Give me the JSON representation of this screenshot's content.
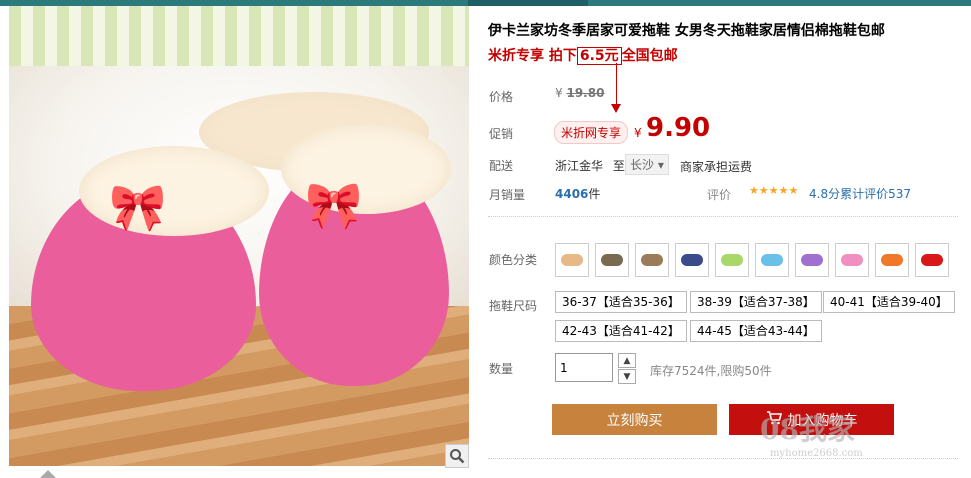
{
  "product": {
    "title": "伊卡兰家坊冬季居家可爱拖鞋 女男冬天拖鞋家居情侣棉拖鞋包邮",
    "promo_prefix": "米折专享 拍下",
    "promo_price": "6.5元",
    "promo_suffix": "全国包邮"
  },
  "price": {
    "label": "价格",
    "currency": "¥",
    "original": "19.80"
  },
  "promotion": {
    "label": "促销",
    "tag": "米折网专享",
    "currency": "¥",
    "price": "9.90"
  },
  "shipping": {
    "label": "配送",
    "from": "浙江金华",
    "to_word": "至",
    "to": "长沙",
    "note": "商家承担运费"
  },
  "sales": {
    "label": "月销量",
    "count": "4406",
    "unit": "件",
    "review_label": "评价",
    "stars": "★★★★★",
    "rating": "4.8分累计评价537"
  },
  "color": {
    "label": "颜色分类",
    "swatches": [
      "#e8b888",
      "#7a6a52",
      "#9a7c5a",
      "#3a4a8a",
      "#a8d86a",
      "#6ac0e8",
      "#a070d0",
      "#f090c0",
      "#f07828",
      "#d81818"
    ]
  },
  "size": {
    "label": "拖鞋尺码",
    "options": [
      "36-37【适合35-36】",
      "38-39【适合37-38】",
      "40-41【适合39-40】",
      "42-43【适合41-42】",
      "44-45【适合43-44】"
    ]
  },
  "quantity": {
    "label": "数量",
    "value": "1",
    "stock": "库存7524件,限购50件"
  },
  "buttons": {
    "buy": "立刻购买",
    "cart": "加入购物车"
  },
  "watermark": {
    "main": "08我家",
    "site": "myhome2668.com"
  },
  "colors": {
    "accent": "#c40000",
    "buy_button": "#c7833d",
    "cart_button": "#c40f0f"
  },
  "icons": {
    "zoom": "magnifier-icon",
    "cart": "cart-icon"
  }
}
